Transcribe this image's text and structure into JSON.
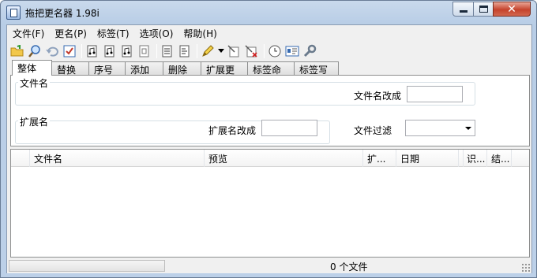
{
  "window": {
    "title": "拖把更名器 1.98i"
  },
  "menu": [
    {
      "label": "文件(F)"
    },
    {
      "label": "更名(P)"
    },
    {
      "label": "标签(T)"
    },
    {
      "label": "选项(O)"
    },
    {
      "label": "帮助(H)"
    }
  ],
  "toolbar": {
    "icons": [
      "open-folder-icon",
      "search-icon",
      "undo-icon",
      "check-icon",
      "doc-music-icon",
      "doc-music-icon",
      "doc-music-icon",
      "doc-music-icon",
      "doc-list-icon",
      "doc-list-icon",
      "highlighter-icon",
      "dropdown-arrow-icon",
      "doc-edit-icon",
      "doc-delete-icon",
      "clock-icon",
      "id-card-icon",
      "wrench-icon"
    ]
  },
  "tabs": [
    {
      "label": "整体",
      "active": true
    },
    {
      "label": "替换"
    },
    {
      "label": "序号"
    },
    {
      "label": "添加"
    },
    {
      "label": "删除"
    },
    {
      "label": "扩展更名"
    },
    {
      "label": "标签命名"
    },
    {
      "label": "标签写入"
    }
  ],
  "panel": {
    "filename_group": "文件名",
    "filename_change_label": "文件名改成",
    "filename_change_value": "",
    "ext_group": "扩展名",
    "ext_change_label": "扩展名改成",
    "ext_change_value": "",
    "filter_label": "文件过滤",
    "filter_value": ""
  },
  "list": {
    "columns": [
      {
        "label": ""
      },
      {
        "label": "文件名"
      },
      {
        "label": "预览"
      },
      {
        "label": "扩..."
      },
      {
        "label": "日期"
      },
      {
        "label": ""
      },
      {
        "label": "识..."
      },
      {
        "label": "结..."
      }
    ]
  },
  "status": {
    "file_count": "0 个文件"
  }
}
